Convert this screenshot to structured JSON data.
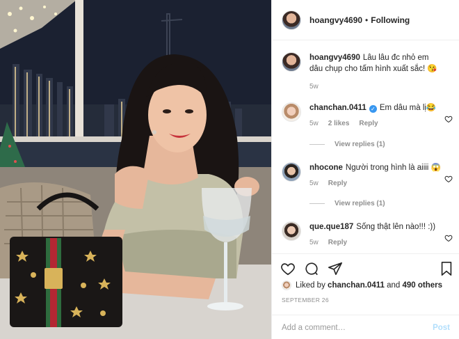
{
  "post": {
    "username": "hoangvy4690",
    "follow_status": "Following",
    "follow_separator": "•",
    "photo_alt": "Woman in a satin slip top smiling at a dinner table with a wine glass and a handbag, city night view behind her"
  },
  "comments": [
    {
      "username": "hoangvy4690",
      "text": "Lâu lâu đc nhỏ em dâu chụp cho tấm hình xuất sắc! 😘",
      "time": "5w",
      "likes": "",
      "reply": "",
      "verified": false,
      "view_replies": ""
    },
    {
      "username": "chanchan.0411",
      "text": "Em dâu mà lị😂",
      "time": "5w",
      "likes": "2 likes",
      "reply": "Reply",
      "verified": true,
      "view_replies": "View replies (1)"
    },
    {
      "username": "nhocone",
      "text": "Người trong hình là aiiii 😱",
      "time": "5w",
      "likes": "",
      "reply": "Reply",
      "verified": false,
      "view_replies": "View replies (1)"
    },
    {
      "username": "que.que187",
      "text": "Sống thật lên nào!!! :))",
      "time": "5w",
      "likes": "",
      "reply": "Reply",
      "verified": false,
      "view_replies": ""
    }
  ],
  "actions": {
    "icons": [
      "heart-icon",
      "comment-icon",
      "share-icon",
      "bookmark-icon"
    ],
    "liked_by_prefix": "Liked by",
    "liked_by_user": "chanchan.0411",
    "liked_by_and": "and",
    "others": "490 others",
    "date": "SEPTEMBER 26"
  },
  "add_comment": {
    "placeholder": "Add a comment…",
    "post_label": "Post"
  },
  "colors": {
    "link_blue": "#3897f0",
    "post_disabled": "#b2dffc",
    "meta_gray": "#8e8e8e",
    "text": "#262626"
  }
}
